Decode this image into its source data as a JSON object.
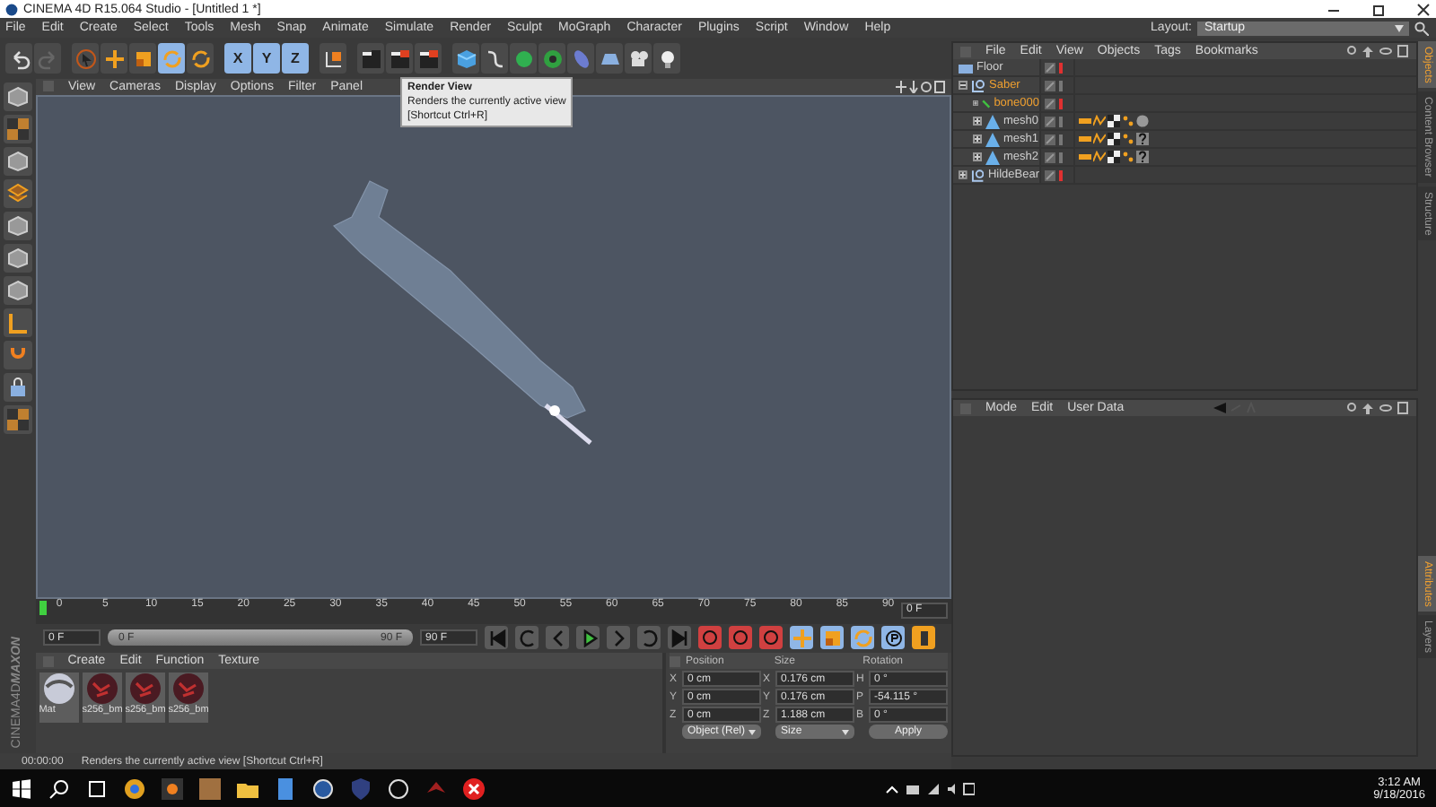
{
  "window": {
    "title": "CINEMA 4D R15.064 Studio - [Untitled 1 *]"
  },
  "menu": [
    "File",
    "Edit",
    "Create",
    "Select",
    "Tools",
    "Mesh",
    "Snap",
    "Animate",
    "Simulate",
    "Render",
    "Sculpt",
    "MoGraph",
    "Character",
    "Plugins",
    "Script",
    "Window",
    "Help"
  ],
  "layout": {
    "label": "Layout:",
    "value": "Startup"
  },
  "toolbar": [
    {
      "kind": "undo",
      "selected": false
    },
    {
      "kind": "redo",
      "selected": false
    },
    {
      "kind": "select",
      "selected": false
    },
    {
      "kind": "move",
      "selected": false
    },
    {
      "kind": "scale",
      "selected": false
    },
    {
      "kind": "rotate",
      "selected": true
    },
    {
      "kind": "recent",
      "selected": false
    },
    {
      "kind": "axis",
      "label": "X",
      "selected": true
    },
    {
      "kind": "axis",
      "label": "Y",
      "selected": true
    },
    {
      "kind": "axis",
      "label": "Z",
      "selected": true
    },
    {
      "kind": "world",
      "selected": false
    },
    {
      "kind": "render-view",
      "selected": false
    },
    {
      "kind": "render-picture",
      "selected": false
    },
    {
      "kind": "render-settings",
      "selected": false
    },
    {
      "kind": "cube",
      "selected": false
    },
    {
      "kind": "spline",
      "selected": false
    },
    {
      "kind": "nurbs",
      "selected": false
    },
    {
      "kind": "array",
      "selected": false
    },
    {
      "kind": "deformer",
      "selected": false
    },
    {
      "kind": "floor",
      "selected": false
    },
    {
      "kind": "camera",
      "selected": false
    },
    {
      "kind": "light",
      "selected": false
    }
  ],
  "tooltip": {
    "title": "Render View",
    "text": "Renders the currently active view",
    "shortcut": "[Shortcut Ctrl+R]"
  },
  "viewport": {
    "checked": false,
    "menu": [
      "View",
      "Cameras",
      "Display",
      "Options",
      "Filter",
      "Panel"
    ]
  },
  "timeline": {
    "ticks": [
      "0",
      "5",
      "10",
      "15",
      "20",
      "25",
      "30",
      "35",
      "40",
      "45",
      "50",
      "55",
      "60",
      "65",
      "70",
      "75",
      "80",
      "85",
      "90"
    ],
    "current": "0 F",
    "start": "0 F",
    "range_start": "0 F",
    "range_end": "90 F",
    "level": 1,
    "end": "90 F"
  },
  "materials": {
    "checked": false,
    "menu": [
      "Create",
      "Edit",
      "Function",
      "Texture"
    ],
    "items": [
      {
        "name": "Mat",
        "kind": "chrome"
      },
      {
        "name": "s256_bm",
        "kind": "texture"
      },
      {
        "name": "s256_bm",
        "kind": "texture"
      },
      {
        "name": "s256_bm",
        "kind": "texture"
      }
    ]
  },
  "brand": {
    "company": "MAXON",
    "product": "CINEMA4D"
  },
  "coordinates": {
    "checked": false,
    "headers": [
      "Position",
      "Size",
      "Rotation"
    ],
    "rows": [
      {
        "axis": "X",
        "position": "0 cm",
        "size_axis": "X",
        "size": "0.176 cm",
        "rotation_axis": "H",
        "rotation": "0 °"
      },
      {
        "axis": "Y",
        "position": "0 cm",
        "size_axis": "Y",
        "size": "0.176 cm",
        "rotation_axis": "P",
        "rotation": "-54.115 °"
      },
      {
        "axis": "Z",
        "position": "0 cm",
        "size_axis": "Z",
        "size": "1.188 cm",
        "rotation_axis": "B",
        "rotation": "0 °"
      }
    ],
    "mode": "Object (Rel)",
    "size_mode": "Size",
    "apply": "Apply"
  },
  "status_bar": {
    "time": "00:00:00",
    "message": "Renders the currently active view [Shortcut Ctrl+R]"
  },
  "objects": {
    "checked": false,
    "menu": [
      "File",
      "Edit",
      "View",
      "Objects",
      "Tags",
      "Bookmarks"
    ],
    "items": [
      {
        "name": "Floor",
        "kind": "floor",
        "selected": false,
        "hidden": true
      },
      {
        "name": "Saber",
        "kind": "null",
        "selected": true,
        "hidden": false,
        "expanded": true,
        "children": [
          {
            "name": "bone000",
            "kind": "joint",
            "selected": true,
            "hidden": true,
            "expanded": false
          },
          {
            "name": "mesh0",
            "kind": "polygon",
            "selected": false,
            "hidden": false,
            "expanded": false,
            "tags": [
              {
                "kind": "skin"
              },
              {
                "kind": "uvw"
              },
              {
                "kind": "texture"
              },
              {
                "kind": "vertex-map"
              },
              {
                "kind": "material"
              }
            ]
          },
          {
            "name": "mesh1",
            "kind": "polygon",
            "selected": false,
            "hidden": false,
            "expanded": false,
            "tags": [
              {
                "kind": "skin"
              },
              {
                "kind": "uvw"
              },
              {
                "kind": "texture"
              },
              {
                "kind": "vertex-map"
              },
              {
                "kind": "missing"
              }
            ]
          },
          {
            "name": "mesh2",
            "kind": "polygon",
            "selected": false,
            "hidden": false,
            "expanded": false,
            "tags": [
              {
                "kind": "skin"
              },
              {
                "kind": "uvw"
              },
              {
                "kind": "texture"
              },
              {
                "kind": "vertex-map"
              },
              {
                "kind": "missing"
              }
            ]
          }
        ]
      },
      {
        "name": "HildeBear",
        "kind": "null",
        "selected": false,
        "hidden": true,
        "expanded": false
      }
    ]
  },
  "attributes": {
    "checked": false,
    "menu": [
      "Mode",
      "Edit",
      "User Data"
    ]
  },
  "side_tabs_top": [
    {
      "label": "Objects",
      "selected": true
    },
    {
      "label": "Content Browser",
      "selected": false
    },
    {
      "label": "Structure",
      "selected": false
    }
  ],
  "side_tabs_bottom": [
    {
      "label": "Attributes",
      "selected": true
    },
    {
      "label": "Layers",
      "selected": false
    }
  ],
  "clock": {
    "time": "3:12 AM",
    "date": "9/18/2016"
  }
}
